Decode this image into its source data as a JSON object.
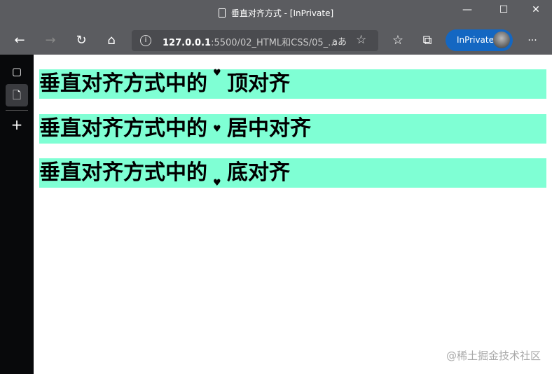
{
  "window": {
    "title": "垂直对齐方式 - [InPrivate]",
    "minimize": "—",
    "maximize": "☐",
    "close": "✕"
  },
  "toolbar": {
    "url_host": "127.0.0.1",
    "url_rest": ":5500/02_HTML和CSS/05_...",
    "read_aloud": "aあ",
    "inprivate_label": "InPrivate",
    "more": "···"
  },
  "rows": [
    {
      "before": "垂直对齐方式中的",
      "icon": "♥",
      "after": "顶对齐"
    },
    {
      "before": "垂直对齐方式中的",
      "icon": "♥",
      "after": "居中对齐"
    },
    {
      "before": "垂直对齐方式中的",
      "icon": "♥",
      "after": "底对齐"
    }
  ],
  "colors": {
    "row_bg": "#7fffd4",
    "chrome": "#5b5c60",
    "accent": "#1467c2"
  },
  "watermark": "@稀土掘金技术社区"
}
